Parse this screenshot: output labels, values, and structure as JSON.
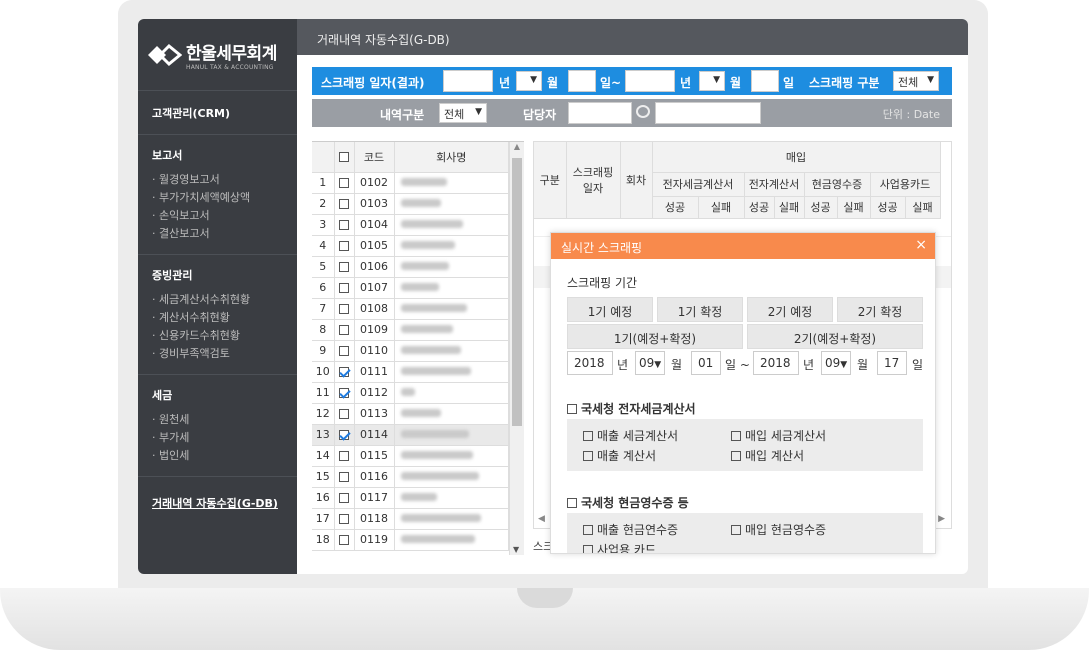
{
  "sidebar": {
    "logo_main": "한울세무회계",
    "logo_sub": "HANUL TAX & ACCOUNTING",
    "crm": "고객관리(CRM)",
    "reports_title": "보고서",
    "reports": [
      "· 월경영보고서",
      "· 부가가치세액예상액",
      "· 손익보고서",
      "· 결산보고서"
    ],
    "evidence_title": "증빙관리",
    "evidence": [
      "· 세금계산서수취현황",
      "· 계산서수취현황",
      "· 신용카드수취현황",
      "· 경비부족액검토"
    ],
    "tax_title": "세금",
    "tax": [
      "· 원천세",
      "· 부가세",
      "· 법인세"
    ],
    "active": "거래내역 자동수집(G-DB)"
  },
  "header": {
    "title": "거래내역 자동수집(G-DB)"
  },
  "filter": {
    "date_label": "스크래핑 일자(결과)",
    "year": "년",
    "month": "월",
    "day_to": "일~",
    "day": "일",
    "type_label": "스크래핑 구분",
    "type_value": "전체",
    "category_label": "내역구분",
    "category_value": "전체",
    "manager_label": "담당자",
    "unit": "단위 : Date"
  },
  "left_table": {
    "headers": [
      "",
      "코드",
      "회사명"
    ],
    "rows": [
      {
        "no": "1",
        "code": "0102",
        "checked": false
      },
      {
        "no": "2",
        "code": "0103",
        "checked": false
      },
      {
        "no": "3",
        "code": "0104",
        "checked": false
      },
      {
        "no": "4",
        "code": "0105",
        "checked": false
      },
      {
        "no": "5",
        "code": "0106",
        "checked": false
      },
      {
        "no": "6",
        "code": "0107",
        "checked": false
      },
      {
        "no": "7",
        "code": "0108",
        "checked": false
      },
      {
        "no": "8",
        "code": "0109",
        "checked": false
      },
      {
        "no": "9",
        "code": "0110",
        "checked": false
      },
      {
        "no": "10",
        "code": "0111",
        "checked": true
      },
      {
        "no": "11",
        "code": "0112",
        "checked": true
      },
      {
        "no": "12",
        "code": "0113",
        "checked": false
      },
      {
        "no": "13",
        "code": "0114",
        "checked": true
      },
      {
        "no": "14",
        "code": "0115",
        "checked": false
      },
      {
        "no": "15",
        "code": "0116",
        "checked": false
      },
      {
        "no": "16",
        "code": "0117",
        "checked": false
      },
      {
        "no": "17",
        "code": "0118",
        "checked": false
      },
      {
        "no": "18",
        "code": "0119",
        "checked": false
      }
    ]
  },
  "right_table": {
    "col_type": "구분",
    "col_date": "스크래핑 일자",
    "col_times": "회차",
    "group": "매입",
    "subgroups": [
      "전자세금계산서",
      "전자계산서",
      "현금영수증",
      "사업용카드"
    ],
    "success": "성공",
    "fail": "실패",
    "footer": "스크"
  },
  "popup": {
    "title": "실시간 스크래핑",
    "close": "×",
    "period_label": "스크래핑 기간",
    "buttons": [
      "1기 예정",
      "1기 확정",
      "2기 예정",
      "2기 확정"
    ],
    "buttons2": [
      "1기(예정+확정)",
      "2기(예정+확정)"
    ],
    "from_year": "2018",
    "from_month": "09",
    "from_day": "01",
    "to_year": "2018",
    "to_month": "09",
    "to_day": "17",
    "year": "년",
    "month": "월",
    "day_to": "일 ~",
    "day": "일",
    "section1": "국세청 전자세금계산서",
    "s1_opts": [
      "매출 세금계산서",
      "매입 세금계산서",
      "매출 계산서",
      "매입 계산서"
    ],
    "section2": "국세청 현금영수증 등",
    "s2_opts": [
      "매출 현금연수증",
      "매입 현금영수증",
      "사업용 카드"
    ]
  }
}
